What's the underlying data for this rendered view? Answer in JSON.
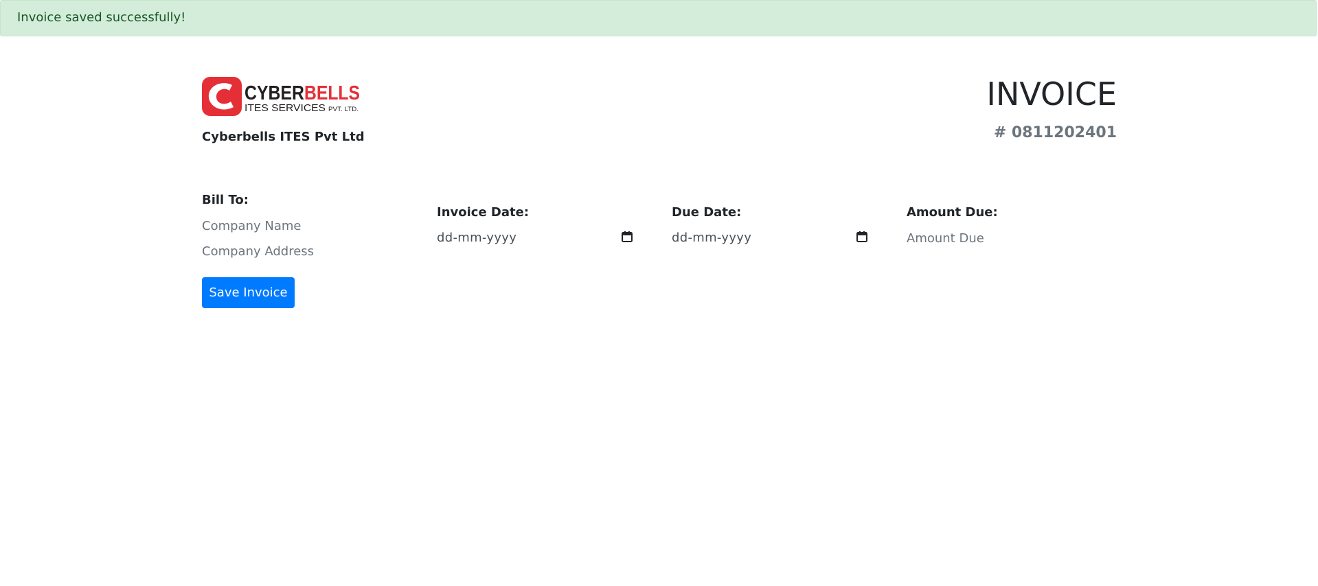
{
  "alert": {
    "message": "Invoice saved successfully!"
  },
  "brand": {
    "logo_text_main_dark": "CYBER",
    "logo_text_main_red": "BELLS",
    "logo_text_sub": "ITES SERVICES",
    "logo_text_small": "PVT. LTD.",
    "company_name": "Cyberbells ITES Pvt Ltd",
    "red": "#e52f37",
    "dark": "#231f20"
  },
  "invoice": {
    "title": "INVOICE",
    "number": "# 0811202401"
  },
  "bill_to": {
    "label": "Bill To:",
    "company_name_placeholder": "Company Name",
    "company_address_placeholder": "Company Address"
  },
  "invoice_date": {
    "label": "Invoice Date:",
    "value": "dd-mm-yyyy"
  },
  "due_date": {
    "label": "Due Date:",
    "value": "dd-mm-yyyy"
  },
  "amount_due": {
    "label": "Amount Due:",
    "placeholder": "Amount Due"
  },
  "actions": {
    "save_label": "Save Invoice"
  },
  "colors": {
    "primary": "#007bff",
    "success_bg": "#d4edda",
    "success_text": "#155724",
    "muted": "#6c757d"
  }
}
